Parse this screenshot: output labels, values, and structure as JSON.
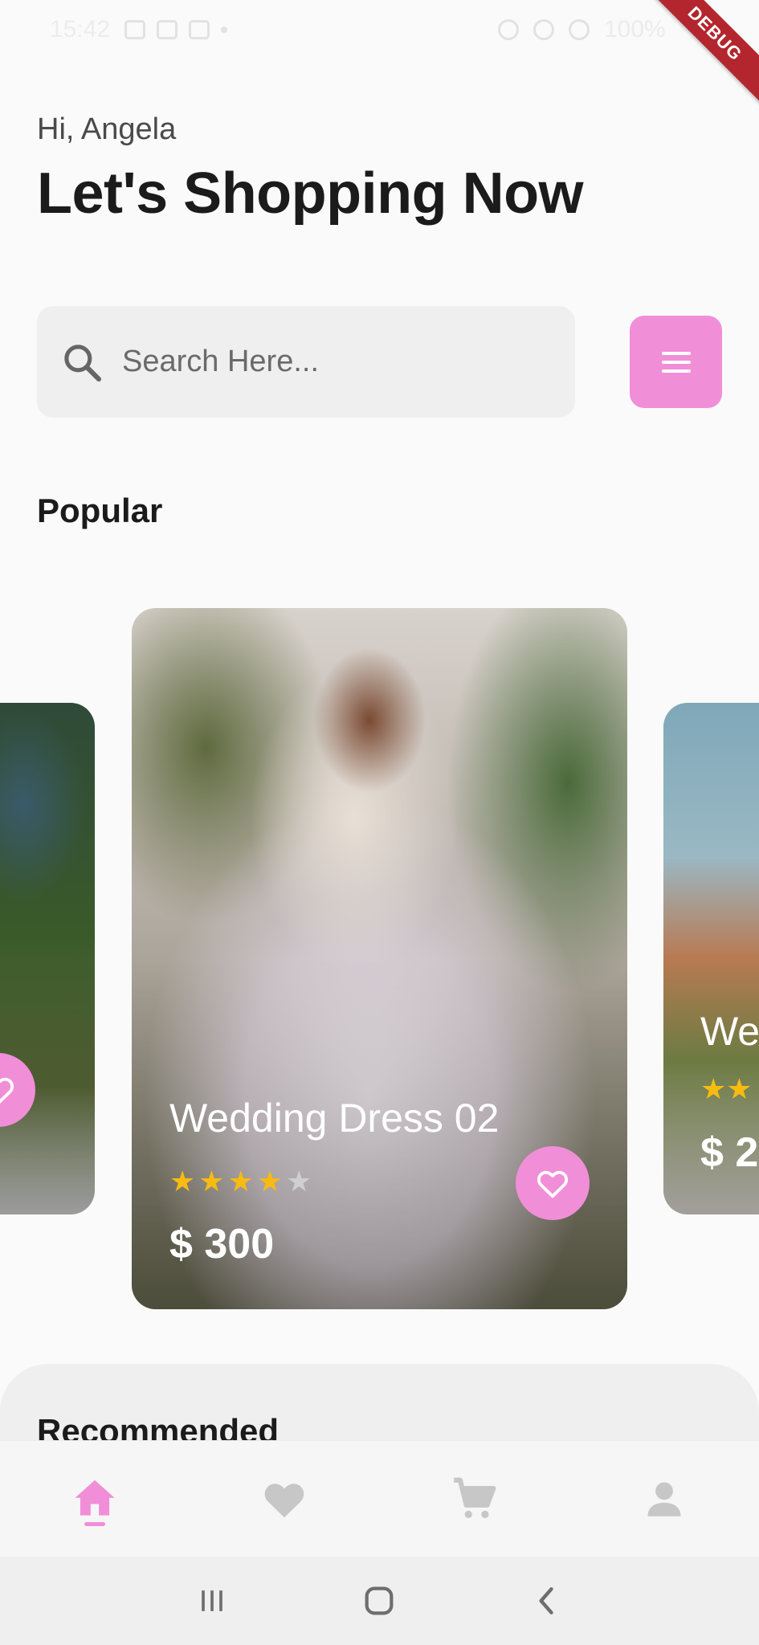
{
  "status_bar": {
    "time": "15:42",
    "battery": "100%",
    "debug_label": "DEBUG"
  },
  "header": {
    "greeting": "Hi, Angela",
    "headline": "Let's Shopping Now"
  },
  "search": {
    "placeholder": "Search Here...",
    "icon": "search-icon"
  },
  "filter_button": {
    "icon": "menu-icon"
  },
  "popular": {
    "title": "Popular",
    "cards": [
      {
        "title": "Wedding Dress 02",
        "rating": 4,
        "max_rating": 5,
        "price": "$ 300"
      },
      {
        "title": "We",
        "price": "$ 2"
      }
    ]
  },
  "recommended": {
    "title": "Recommended"
  },
  "bottom_nav": {
    "items": [
      "home-icon",
      "heart-icon",
      "cart-icon",
      "profile-icon"
    ],
    "active": 0
  },
  "colors": {
    "accent": "#f18ed8",
    "star": "#f7bb11",
    "star_empty": "#cfcfcf"
  }
}
